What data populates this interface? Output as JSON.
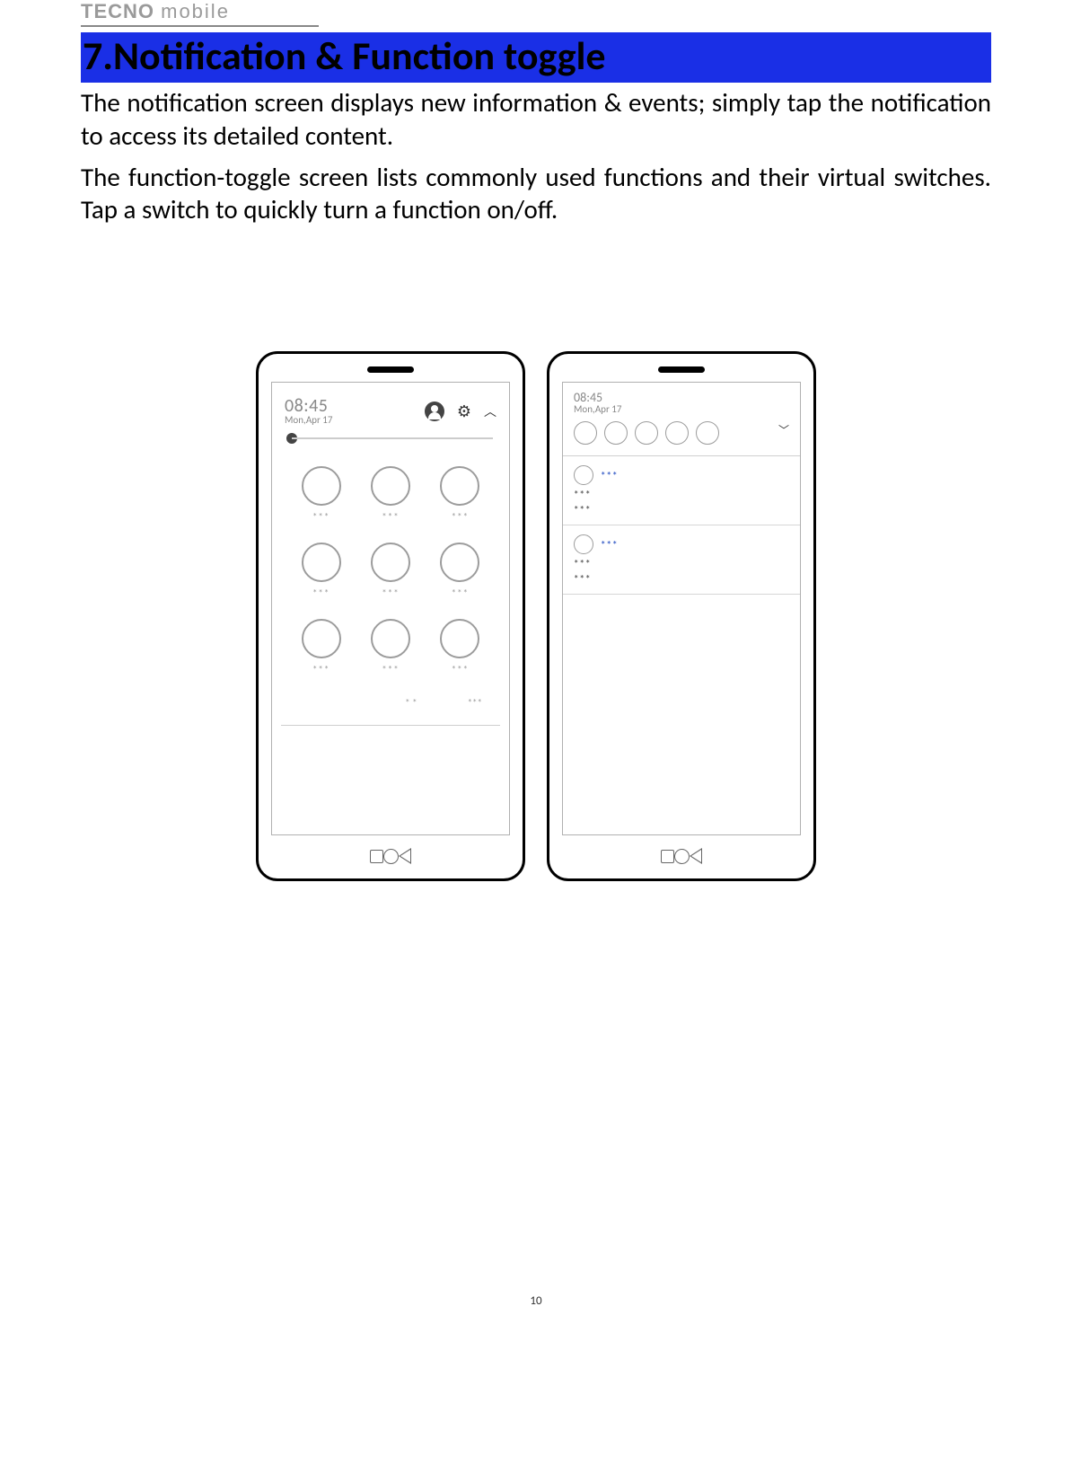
{
  "brand": {
    "name_main": "TECNO",
    "name_sub": "mobile"
  },
  "heading": "7.Notification & Function toggle",
  "para1": "The notification screen displays new information & events; simply tap the notification to access its detailed content.",
  "para2": "The function-toggle screen lists commonly used functions and their virtual switches. Tap a switch to quickly turn a function on/off.",
  "phone1": {
    "time": "08:45",
    "date": "Mon,Apr 17",
    "toggles": [
      "***",
      "***",
      "***",
      "***",
      "***",
      "***",
      "***",
      "***",
      "***"
    ],
    "bottom_left": "* *",
    "bottom_right": "***"
  },
  "phone2": {
    "time": "08:45",
    "date": "Mon,Apr 17",
    "mini_toggle_count": 5,
    "notifications": [
      {
        "app": "***",
        "line1": "***",
        "line2": "***"
      },
      {
        "app": "***",
        "line1": "***",
        "line2": "***"
      }
    ]
  },
  "page_number": "10"
}
